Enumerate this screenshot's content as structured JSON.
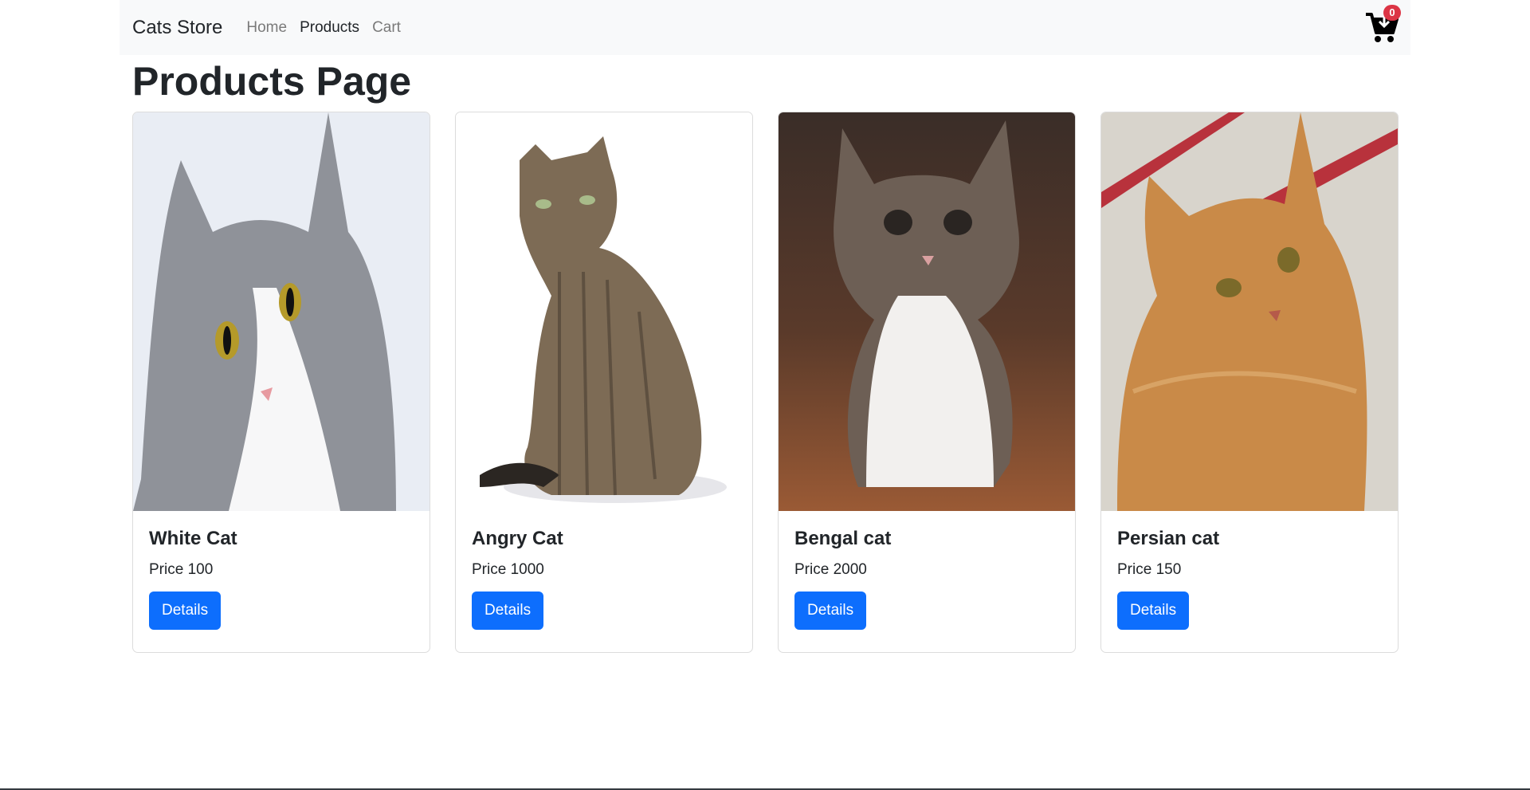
{
  "navbar": {
    "brand": "Cats Store",
    "links": [
      {
        "label": "Home",
        "active": false
      },
      {
        "label": "Products",
        "active": true
      },
      {
        "label": "Cart",
        "active": false
      }
    ],
    "cart_icon": "shopping-cart-icon",
    "cart_count": "0"
  },
  "page": {
    "title": "Products Page"
  },
  "products": [
    {
      "name": "White Cat",
      "price": "Price 100",
      "button": "Details",
      "image": "white-gray-cat-photo"
    },
    {
      "name": "Angry Cat",
      "price": "Price 1000",
      "button": "Details",
      "image": "tabby-cat-sitting-photo"
    },
    {
      "name": "Bengal cat",
      "price": "Price 2000",
      "button": "Details",
      "image": "tabby-white-kitten-photo"
    },
    {
      "name": "Persian cat",
      "price": "Price 150",
      "button": "Details",
      "image": "orange-cat-photo"
    }
  ],
  "colors": {
    "primary": "#0d6efd",
    "badge": "#dc3545",
    "navbar_bg": "#f8f9fa"
  }
}
